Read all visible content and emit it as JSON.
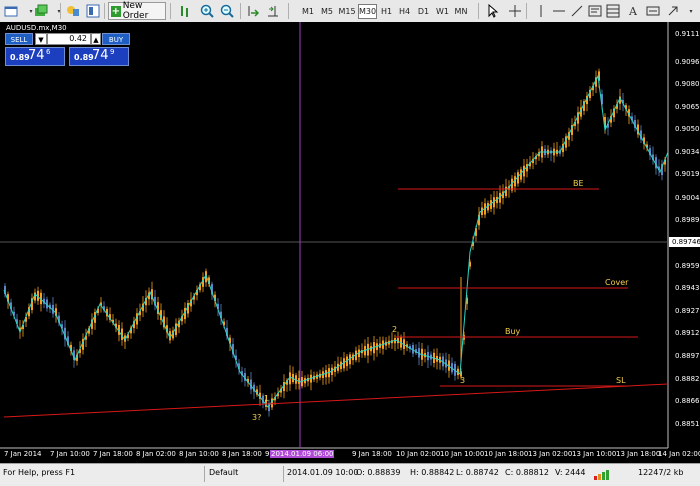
{
  "toolbar": {
    "new_order_label": "New Order",
    "timeframes": [
      "M1",
      "M5",
      "M15",
      "M30",
      "H1",
      "H4",
      "D1",
      "W1",
      "MN"
    ],
    "selected_timeframe": "M30"
  },
  "chart": {
    "title": "AUDUSD.mx,M30",
    "trade_panel": {
      "sell_label": "SELL",
      "buy_label": "BUY",
      "lot_value": "0.42",
      "arrow_down": "▼",
      "arrow_up": "▲",
      "sell_price_small": "0.89",
      "sell_price_big": "74",
      "sell_price_sup": "6",
      "buy_price_small": "0.89",
      "buy_price_big": "74",
      "buy_price_sup": "9"
    },
    "price_labels": [
      "0.91110",
      "0.90960",
      "0.90805",
      "0.90650",
      "0.90500",
      "0.90345",
      "0.90195",
      "0.90040",
      "0.89890",
      "0.89595",
      "0.89430",
      "0.89275",
      "0.89125",
      "0.88970",
      "0.88820",
      "0.88665",
      "0.88515"
    ],
    "current_price": "0.89746",
    "time_labels": [
      "7 Jan 2014",
      "7 Jan 10:00",
      "7 Jan 18:00",
      "8 Jan 02:00",
      "8 Jan 10:00",
      "8 Jan 18:00",
      "9",
      "9 Jan 18:00",
      "10 Jan 02:00",
      "10 Jan 10:00",
      "10 Jan 18:00",
      "13 Jan 02:00",
      "13 Jan 10:00",
      "13 Jan 18:00",
      "14 Jan 02:00"
    ],
    "highlight_time": "2014.01.09 06:00",
    "annotations": {
      "be": "BE",
      "cover": "Cover",
      "buy": "Buy",
      "sl": "SL",
      "p1": "1",
      "p2": "2",
      "p3": "3",
      "p3q": "3?"
    },
    "colors": {
      "bull": "#f5a020",
      "bear": "#5b86c8",
      "zigzag": "#2fd3c6",
      "level": "#d81818",
      "crosshair": "#a040c0"
    }
  },
  "statusbar": {
    "help": "For Help, press F1",
    "profile": "Default",
    "datetime": "2014.01.09 10:00",
    "open": "O: 0.88839",
    "high": "H: 0.88842",
    "low": "L: 0.88742",
    "close": "C: 0.88812",
    "volume": "V: 2444",
    "traffic": "12247/2 kb"
  }
}
